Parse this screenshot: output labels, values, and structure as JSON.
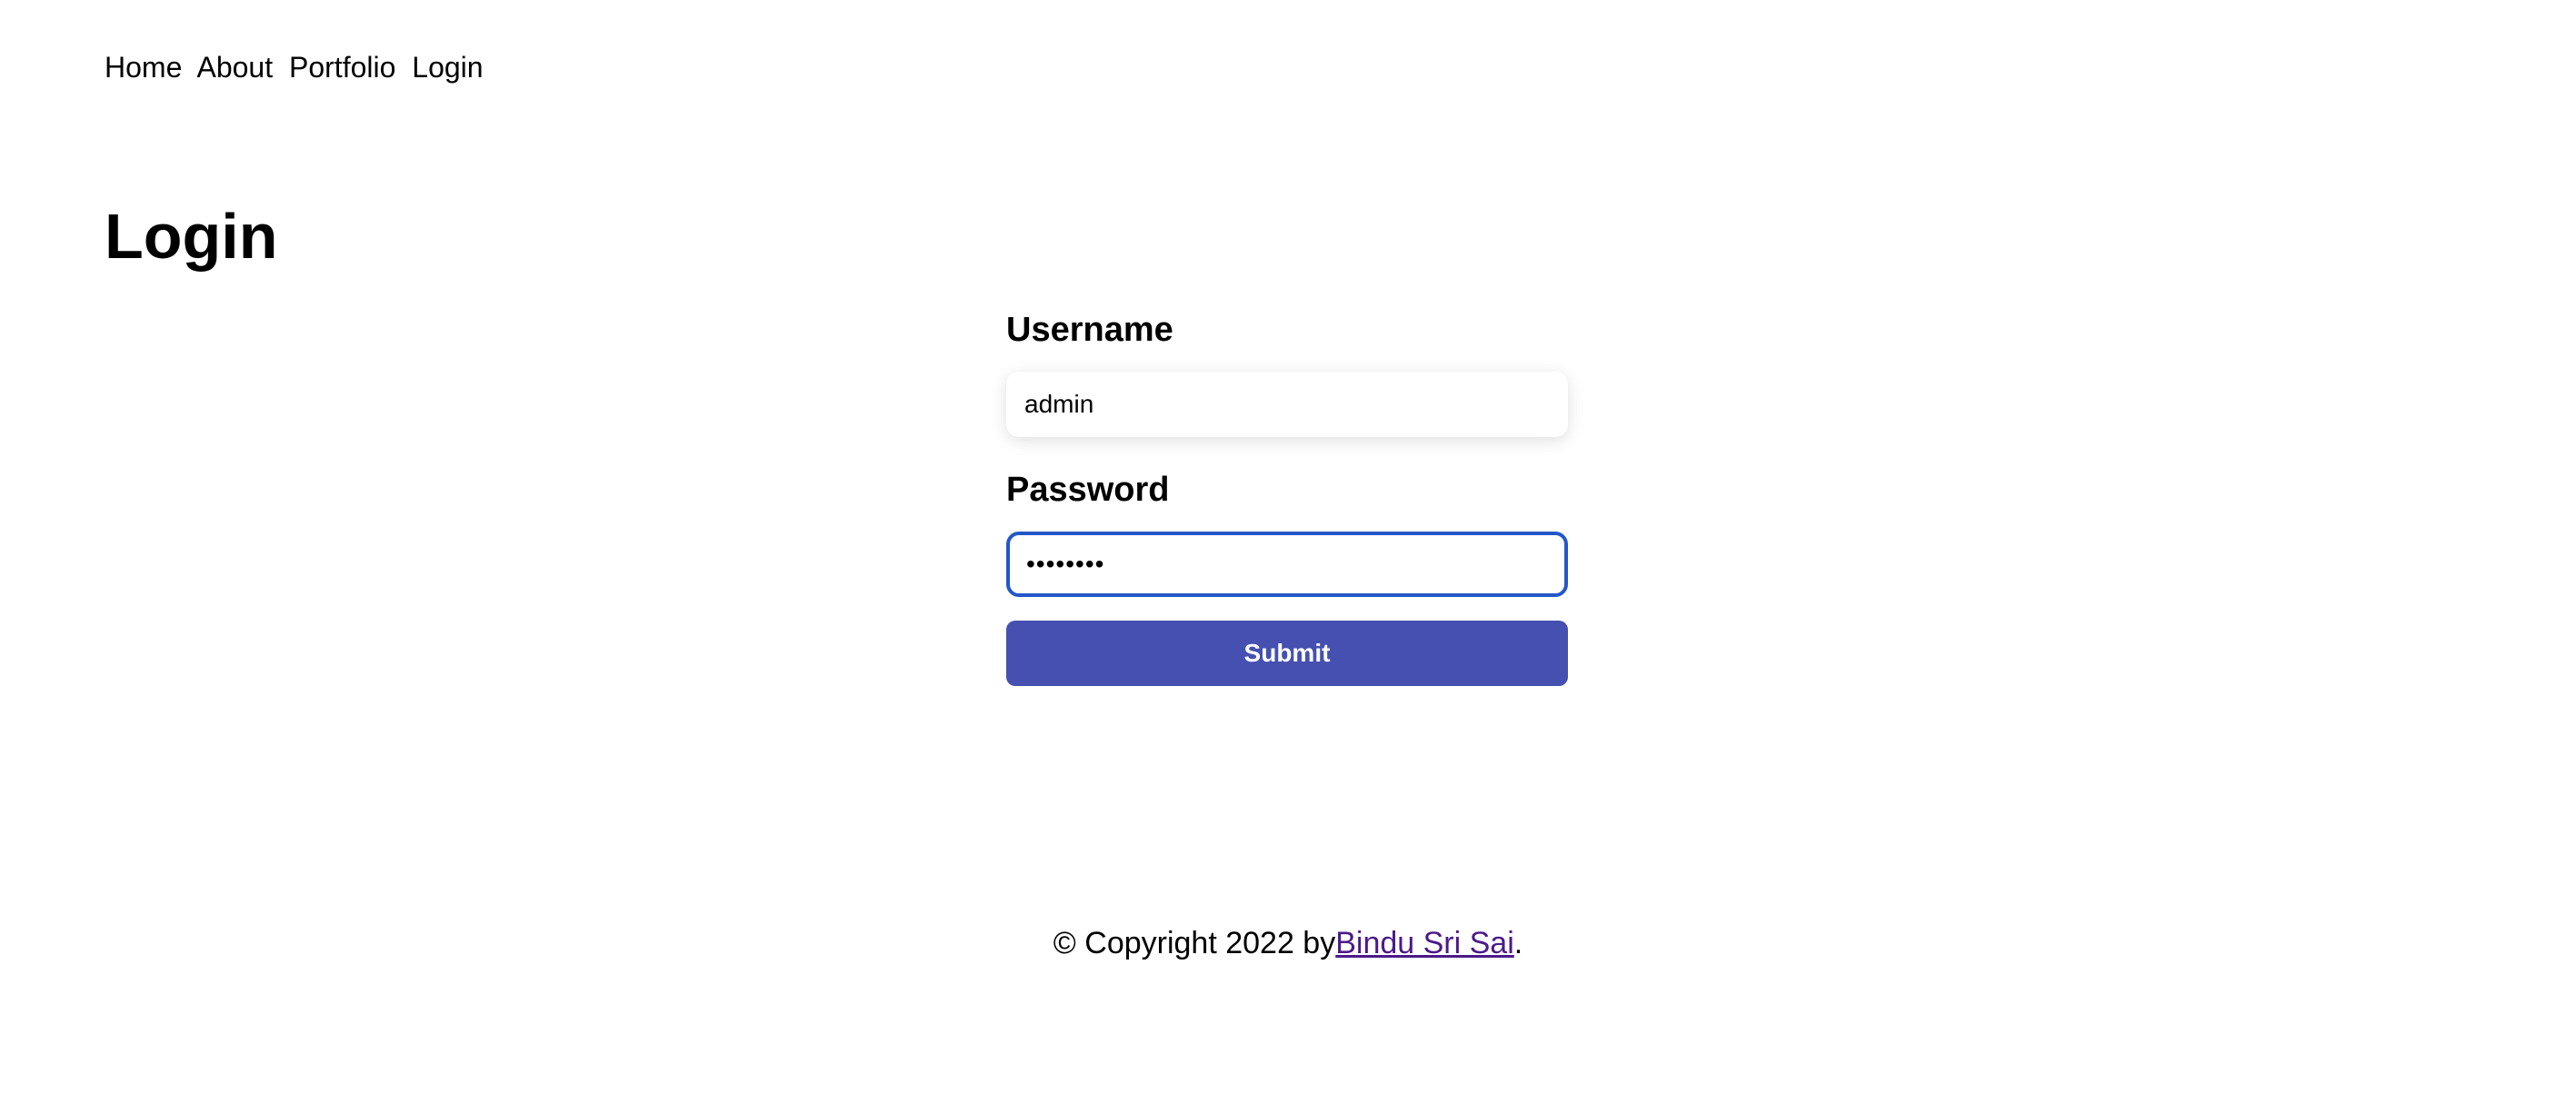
{
  "nav": {
    "items": [
      "Home",
      "About",
      "Portfolio",
      "Login"
    ]
  },
  "page": {
    "title": "Login"
  },
  "form": {
    "username_label": "Username",
    "username_value": "admin",
    "password_label": "Password",
    "password_value": "••••••••",
    "submit_label": "Submit"
  },
  "footer": {
    "prefix": "© Copyright 2022 by",
    "author_link": "Bindu Sri Sai",
    "suffix": "."
  },
  "colors": {
    "button_bg": "#4550b0",
    "focus_border": "#2458c8",
    "link": "#4b1a8a"
  }
}
